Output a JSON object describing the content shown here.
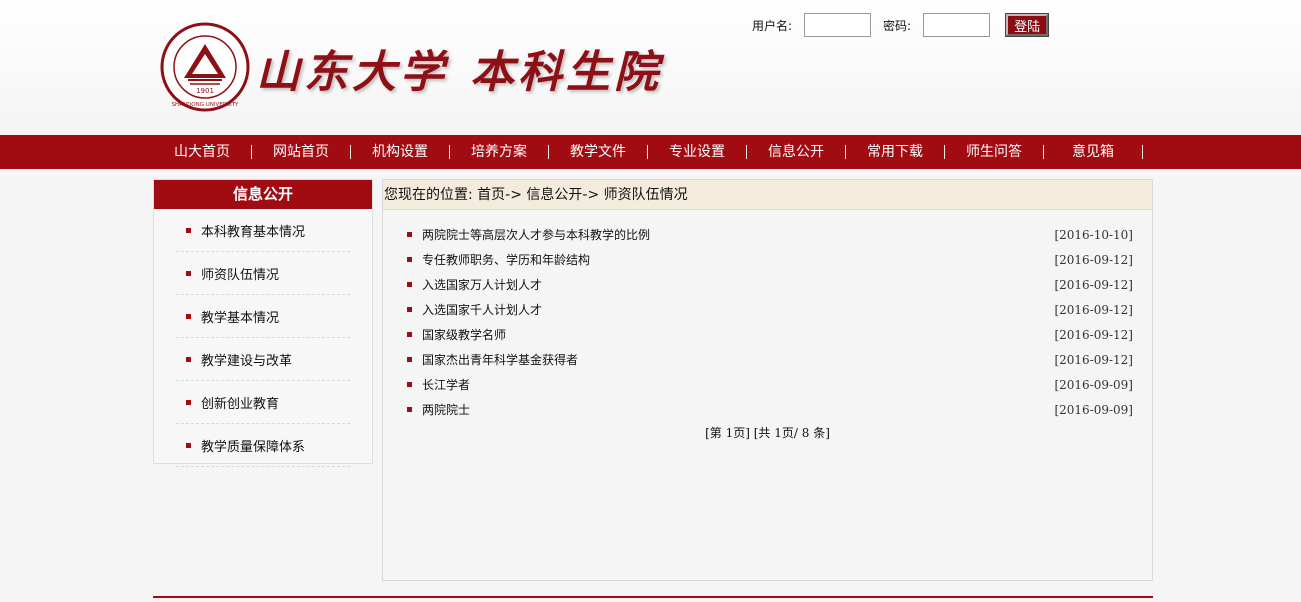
{
  "header": {
    "logo_text_1": "山东大学",
    "logo_text_2": "本科生院",
    "seal_year": "1901",
    "seal_caption": "SHANDONG UNIVERSITY"
  },
  "login": {
    "username_label": "用户名:",
    "password_label": "密码:",
    "login_button": "登陆",
    "username_value": "",
    "password_value": ""
  },
  "nav": {
    "items": [
      {
        "label": "山大首页"
      },
      {
        "label": "网站首页"
      },
      {
        "label": "机构设置"
      },
      {
        "label": "培养方案"
      },
      {
        "label": "教学文件"
      },
      {
        "label": "专业设置"
      },
      {
        "label": "信息公开"
      },
      {
        "label": "常用下载"
      },
      {
        "label": "师生问答"
      },
      {
        "label": "意见箱"
      }
    ]
  },
  "sidebar": {
    "title": "信息公开",
    "items": [
      {
        "label": "本科教育基本情况"
      },
      {
        "label": "师资队伍情况"
      },
      {
        "label": "教学基本情况"
      },
      {
        "label": "教学建设与改革"
      },
      {
        "label": "创新创业教育"
      },
      {
        "label": "教学质量保障体系"
      }
    ]
  },
  "main": {
    "breadcrumb": "您现在的位置: 首页-> 信息公开-> 师资队伍情况",
    "articles": [
      {
        "title": "两院院士等高层次人才参与本科教学的比例",
        "date": "[2016-10-10]"
      },
      {
        "title": "专任教师职务、学历和年龄结构",
        "date": "[2016-09-12]"
      },
      {
        "title": "入选国家万人计划人才",
        "date": "[2016-09-12]"
      },
      {
        "title": "入选国家千人计划人才",
        "date": "[2016-09-12]"
      },
      {
        "title": "国家级教学名师",
        "date": "[2016-09-12]"
      },
      {
        "title": "国家杰出青年科学基金获得者",
        "date": "[2016-09-12]"
      },
      {
        "title": "长江学者",
        "date": "[2016-09-09]"
      },
      {
        "title": "两院院士",
        "date": "[2016-09-09]"
      }
    ],
    "pager": "[第 1页] [共 1页/ 8 条]"
  },
  "colors": {
    "brand": "#a10b12",
    "breadcrumb_bg": "#f3ecdc"
  }
}
